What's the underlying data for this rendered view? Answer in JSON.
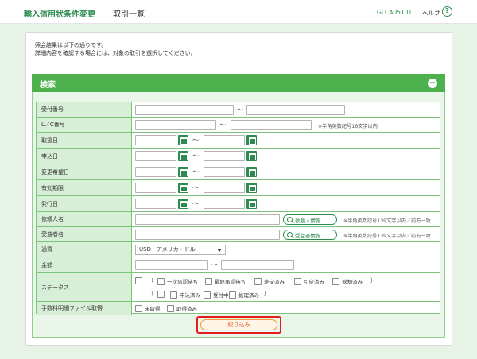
{
  "header": {
    "title": "輸入信用状条件変更",
    "subtitle": "取引一覧",
    "screen_code": "GLCA05101",
    "help_label": "ヘルプ",
    "help_icon": "?"
  },
  "intro": {
    "line1": "照会結果は以下の通りです。",
    "line2": "詳細内容を確認する場合には、対象の取引を選択してください。"
  },
  "search": {
    "title": "検索",
    "collapse_icon": "−",
    "fields": {
      "accept_no": "受付番号",
      "lc_no": "L／C番号",
      "lc_note": "※半角英数記号16文字以内",
      "handling_date": "取扱日",
      "apply_date": "申込日",
      "change_date": "変更希望日",
      "expiry": "有効期限",
      "issue_date": "発行日",
      "applicant": "依頼人名",
      "applicant_btn": "依頼人情報",
      "applicant_note": "※半角英数記号139文字以内／前方一致",
      "beneficiary": "受益者名",
      "beneficiary_btn": "受益者情報",
      "beneficiary_note": "※半角英数記号139文字以内／前方一致",
      "currency": "通貨",
      "currency_value": "USD　アメリカ・ドル",
      "amount": "金額",
      "status": "ステータス",
      "fee_file": "手数料明細ファイル取得"
    },
    "tilde": "～",
    "status_row1": [
      "一次承認待ち",
      "最終承認待ち",
      "差戻済み",
      "引戻済み",
      "返却済み"
    ],
    "status_row2": [
      "申込済み",
      "受付中",
      "処理済み"
    ],
    "paren_open": "（",
    "paren_close": "）",
    "fee_options": [
      "未取得",
      "取得済み"
    ],
    "submit_label": "絞り込み"
  }
}
